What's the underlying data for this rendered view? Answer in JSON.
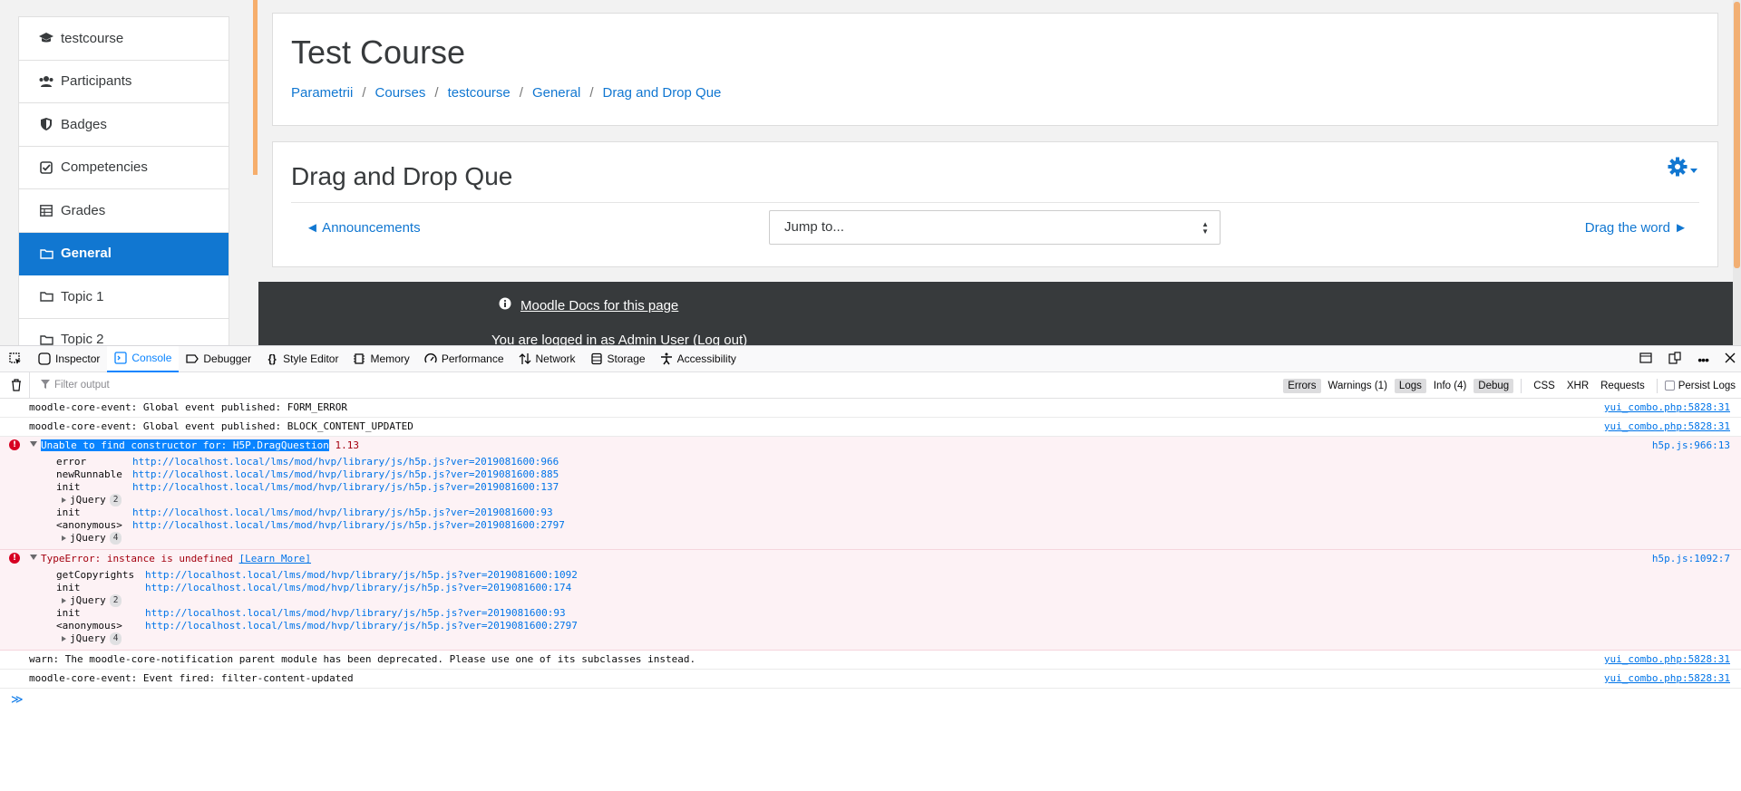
{
  "sidebar": {
    "items": [
      {
        "label": "testcourse",
        "icon": "graduation-cap-icon"
      },
      {
        "label": "Participants",
        "icon": "users-icon"
      },
      {
        "label": "Badges",
        "icon": "shield-icon"
      },
      {
        "label": "Competencies",
        "icon": "check-square-icon"
      },
      {
        "label": "Grades",
        "icon": "table-icon"
      },
      {
        "label": "General",
        "icon": "folder-icon",
        "active": true
      },
      {
        "label": "Topic 1",
        "icon": "folder-icon"
      },
      {
        "label": "Topic 2",
        "icon": "folder-icon"
      }
    ]
  },
  "header": {
    "title": "Test Course",
    "breadcrumb": [
      "Parametrii",
      "Courses",
      "testcourse",
      "General",
      "Drag and Drop Que"
    ]
  },
  "activity": {
    "title": "Drag and Drop Que",
    "prev_link": "◄ Announcements",
    "jump_placeholder": "Jump to...",
    "next_link": "Drag the word ►"
  },
  "footer": {
    "docs_link": "Moodle Docs for this page",
    "login_text": "You are logged in as Admin User (Log out)"
  },
  "devtools": {
    "tabs": [
      "Inspector",
      "Console",
      "Debugger",
      "Style Editor",
      "Memory",
      "Performance",
      "Network",
      "Storage",
      "Accessibility"
    ],
    "active_tab": "Console",
    "filter_placeholder": "Filter output",
    "filter_buttons": {
      "errors": "Errors",
      "warnings": "Warnings (1)",
      "logs": "Logs",
      "info": "Info (4)",
      "debug": "Debug",
      "css": "CSS",
      "xhr": "XHR",
      "requests": "Requests",
      "persist": "Persist Logs"
    },
    "messages": {
      "m1": {
        "text": "moodle-core-event: Global event published: FORM_ERROR",
        "loc": "yui_combo.php:5828:31"
      },
      "m2": {
        "text": "moodle-core-event: Global event published: BLOCK_CONTENT_UPDATED",
        "loc": "yui_combo.php:5828:31"
      },
      "e1": {
        "highlight": "Unable to find constructor for: H5P.DragQuestion",
        "version": "1.13",
        "loc": "h5p.js:966:13",
        "frames": [
          {
            "fn": "error",
            "url": "http://localhost.local/lms/mod/hvp/library/js/h5p.js?ver=2019081600:966"
          },
          {
            "fn": "newRunnable",
            "url": "http://localhost.local/lms/mod/hvp/library/js/h5p.js?ver=2019081600:885"
          },
          {
            "fn": "init",
            "url": "http://localhost.local/lms/mod/hvp/library/js/h5p.js?ver=2019081600:137"
          },
          {
            "fn": "init",
            "url": "http://localhost.local/lms/mod/hvp/library/js/h5p.js?ver=2019081600:93"
          },
          {
            "fn": "<anonymous>",
            "url": "http://localhost.local/lms/mod/hvp/library/js/h5p.js?ver=2019081600:2797"
          }
        ],
        "group1": {
          "label": "jQuery",
          "count": "2"
        },
        "group2": {
          "label": "jQuery",
          "count": "4"
        }
      },
      "e2": {
        "text": "TypeError: instance is undefined",
        "learn_more": "[Learn More]",
        "loc": "h5p.js:1092:7",
        "frames": [
          {
            "fn": "getCopyrights",
            "url": "http://localhost.local/lms/mod/hvp/library/js/h5p.js?ver=2019081600:1092"
          },
          {
            "fn": "init",
            "url": "http://localhost.local/lms/mod/hvp/library/js/h5p.js?ver=2019081600:174"
          },
          {
            "fn": "init",
            "url": "http://localhost.local/lms/mod/hvp/library/js/h5p.js?ver=2019081600:93"
          },
          {
            "fn": "<anonymous>",
            "url": "http://localhost.local/lms/mod/hvp/library/js/h5p.js?ver=2019081600:2797"
          }
        ],
        "group1": {
          "label": "jQuery",
          "count": "2"
        },
        "group2": {
          "label": "jQuery",
          "count": "4"
        }
      },
      "m3": {
        "text": "warn: The moodle-core-notification parent module has been deprecated. Please use one of its subclasses instead.",
        "loc": "yui_combo.php:5828:31"
      },
      "m4": {
        "text": "moodle-core-event: Event fired: filter-content-updated",
        "loc": "yui_combo.php:5828:31"
      }
    },
    "prompt_symbol": "≫"
  },
  "colors": {
    "accent": "#1177d1",
    "orange": "#f98012",
    "error_bg": "#fdf2f5",
    "footer_bg": "#373a3c"
  }
}
